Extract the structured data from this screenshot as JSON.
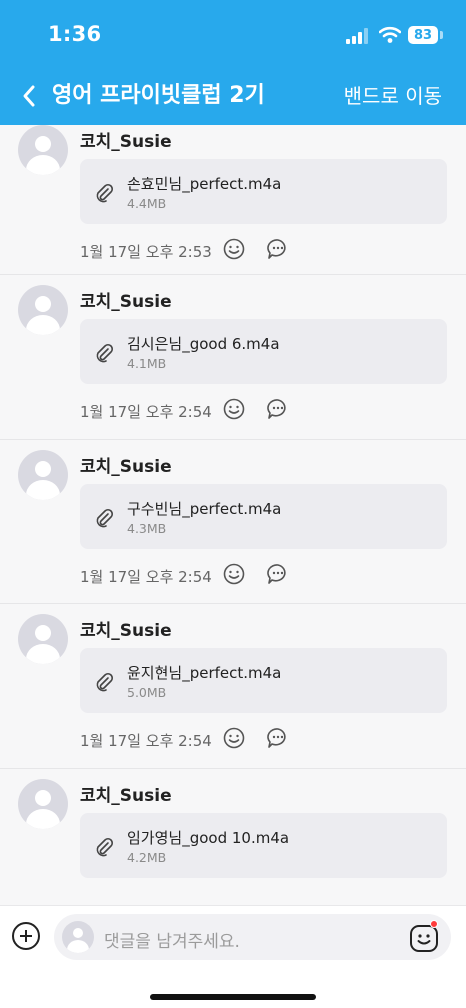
{
  "status": {
    "time": "1:36",
    "battery": "83"
  },
  "header": {
    "title": "영어 프라이빗클럽 2기",
    "move_label": "밴드로 이동"
  },
  "posts": [
    {
      "author": "코치_Susie",
      "file_name": "손효민님_perfect.m4a",
      "file_size": "4.4MB",
      "time": "1월 17일 오후 2:53"
    },
    {
      "author": "코치_Susie",
      "file_name": "김시은님_good 6.m4a",
      "file_size": "4.1MB",
      "time": "1월 17일 오후 2:54"
    },
    {
      "author": "코치_Susie",
      "file_name": "구수빈님_perfect.m4a",
      "file_size": "4.3MB",
      "time": "1월 17일 오후 2:54"
    },
    {
      "author": "코치_Susie",
      "file_name": "윤지현님_perfect.m4a",
      "file_size": "5.0MB",
      "time": "1월 17일 오후 2:54"
    },
    {
      "author": "코치_Susie",
      "file_name": "임가영님_good 10.m4a",
      "file_size": "4.2MB",
      "time": ""
    }
  ],
  "composer": {
    "placeholder": "댓글을 남겨주세요."
  },
  "colors": {
    "header_bg": "#28a9ec",
    "notification_dot": "#ff3b3b"
  },
  "icons": [
    "back-icon",
    "paperclip-icon",
    "emoji-react-icon",
    "comment-icon",
    "add-icon",
    "sticker-emoji-icon"
  ]
}
